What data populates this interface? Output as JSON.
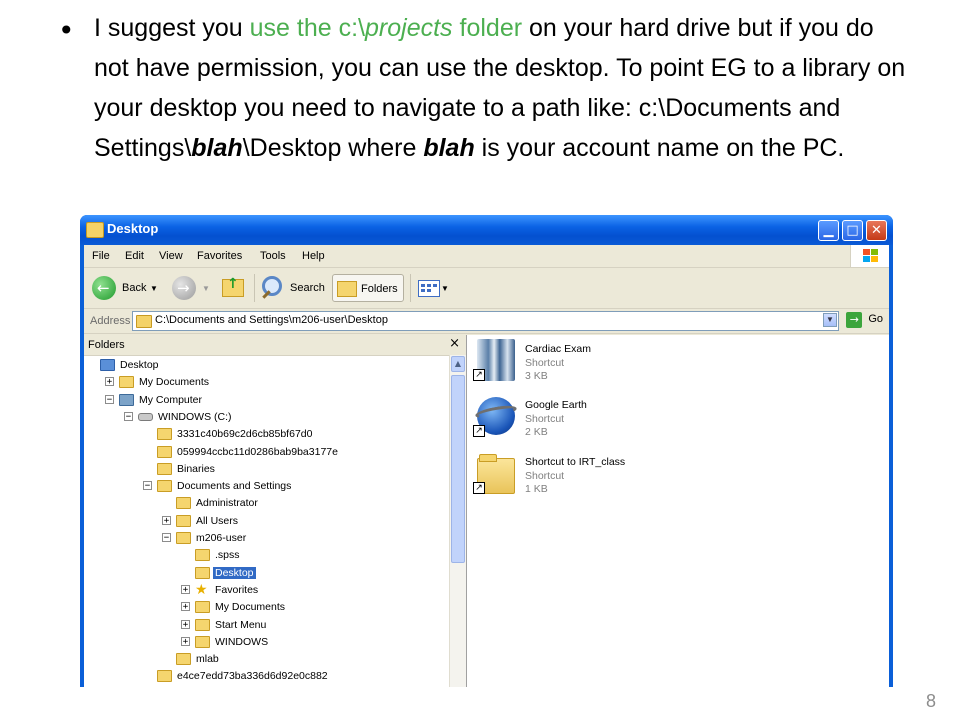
{
  "slide": {
    "bullet": "•",
    "text_part1": "I suggest you ",
    "text_hl1": "use the c:\\",
    "text_hl_italic": "projects",
    "text_hl2": " folder",
    "text_part2": " on your hard drive but if you do not have permission, you can use the desktop.  To point EG to a library on your desktop you need to navigate to a path like:  c:\\Documents and Settings\\",
    "text_bold1": "blah",
    "text_part3": "\\Desktop where ",
    "text_bold2": "blah",
    "text_part4": " is your account name on the PC.",
    "page_number": "8",
    "highlight_color": "#4caf50"
  },
  "window": {
    "title": "Desktop",
    "title_icon": "folder-icon"
  },
  "menu": [
    "File",
    "Edit",
    "View",
    "Favorites",
    "Tools",
    "Help"
  ],
  "toolbar": {
    "back_label": "Back",
    "search_label": "Search",
    "folders_label": "Folders"
  },
  "address": {
    "label": "Address",
    "value": "C:\\Documents and Settings\\m206-user\\Desktop",
    "go_label": "Go"
  },
  "folders_pane": {
    "title": "Folders",
    "close": "×",
    "tree": [
      {
        "label": "Desktop",
        "icon": "desktop-icon",
        "exp": ""
      },
      {
        "label": "My Documents",
        "icon": "my-documents-icon",
        "exp": "+"
      },
      {
        "label": "My Computer",
        "icon": "my-computer-icon",
        "exp": "−"
      },
      {
        "label": "WINDOWS (C:)",
        "icon": "drive-icon",
        "exp": "−"
      },
      {
        "label": "3331c40b69c2d6cb85bf67d0",
        "icon": "folder-icon",
        "exp": ""
      },
      {
        "label": "059994ccbc11d0286bab9ba3177e",
        "icon": "folder-icon",
        "exp": ""
      },
      {
        "label": "Binaries",
        "icon": "folder-icon",
        "exp": ""
      },
      {
        "label": "Documents and Settings",
        "icon": "folder-icon",
        "exp": "−"
      },
      {
        "label": "Administrator",
        "icon": "folder-icon",
        "exp": ""
      },
      {
        "label": "All Users",
        "icon": "folder-icon",
        "exp": "+"
      },
      {
        "label": "m206-user",
        "icon": "folder-icon",
        "exp": "−"
      },
      {
        "label": ".spss",
        "icon": "folder-icon",
        "exp": ""
      },
      {
        "label": "Desktop",
        "icon": "folder-icon",
        "exp": "",
        "selected": true
      },
      {
        "label": "Favorites",
        "icon": "favorites-star-icon",
        "exp": "+"
      },
      {
        "label": "My Documents",
        "icon": "folder-icon",
        "exp": "+"
      },
      {
        "label": "Start Menu",
        "icon": "folder-icon",
        "exp": "+"
      },
      {
        "label": "WINDOWS",
        "icon": "folder-icon",
        "exp": "+"
      },
      {
        "label": "mlab",
        "icon": "folder-icon",
        "exp": ""
      },
      {
        "label": "e4ce7edd73ba336d6d92e0c882",
        "icon": "folder-icon",
        "exp": ""
      }
    ]
  },
  "files": [
    {
      "name": "Cardiac Exam",
      "type": "Shortcut",
      "size": "3 KB",
      "icon": "cardiac-exam-icon"
    },
    {
      "name": "Google Earth",
      "type": "Shortcut",
      "size": "2 KB",
      "icon": "google-earth-icon"
    },
    {
      "name": "Shortcut to IRT_class",
      "type": "Shortcut",
      "size": "1 KB",
      "icon": "folder-shortcut-icon"
    }
  ]
}
